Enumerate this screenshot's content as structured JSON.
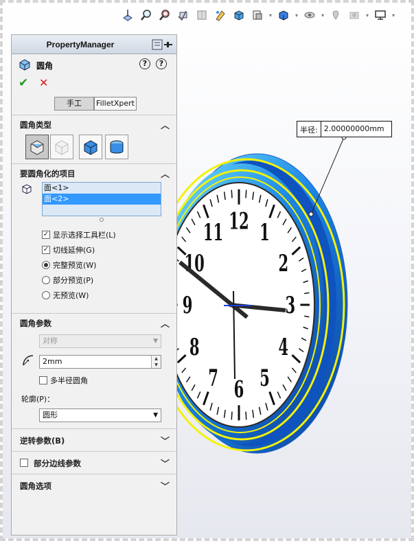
{
  "property_manager": {
    "title": "PropertyManager",
    "feature_name": "圆角",
    "tabs": {
      "manual": "手工",
      "filletxpert": "FilletXpert"
    }
  },
  "fillet_type": {
    "heading": "圆角类型"
  },
  "items": {
    "heading": "要圆角化的项目",
    "list": [
      "面<1>",
      "面<2>"
    ],
    "selected_index": 1,
    "show_toolbar_label": "显示选择工具栏(L)",
    "tangent_label": "切线延伸(G)",
    "preview_options": [
      "完整预览(W)",
      "部分预览(P)",
      "无预览(W)"
    ],
    "preview_selected_index": 0
  },
  "params": {
    "heading": "圆角参数",
    "method": "对称",
    "radius": "2mm",
    "multi_radius_label": "多半径圆角",
    "profile_label": "轮廓(P)：",
    "profile_value": "圆形"
  },
  "collapsed_sections": [
    "逆转参数(B)",
    "部分边线参数",
    "圆角选项"
  ],
  "callout": {
    "label": "半径:",
    "value": "2.00000000mm"
  },
  "clock": {
    "numerals": [
      "12",
      "1",
      "2",
      "3",
      "4",
      "5",
      "6",
      "7",
      "8",
      "9",
      "10",
      "11"
    ]
  },
  "hud_icons": [
    "normal-to-icon",
    "zoom-to-fit-icon",
    "zoom-area-icon",
    "previous-view-icon",
    "section-view-icon",
    "dynamic-annotation-icon",
    "view-orientation-icon",
    "display-style-icon",
    "hide-show-icon",
    "edit-appearance-icon",
    "apply-scene-icon",
    "view-settings-icon",
    "monitor-icon"
  ],
  "colors": {
    "accent": "#3399ff",
    "rim_blue": "#1b6fd8",
    "highlight_yellow": "#f2f20a",
    "ok_green": "#1a9a1a",
    "cancel_red": "#d41a1a"
  }
}
